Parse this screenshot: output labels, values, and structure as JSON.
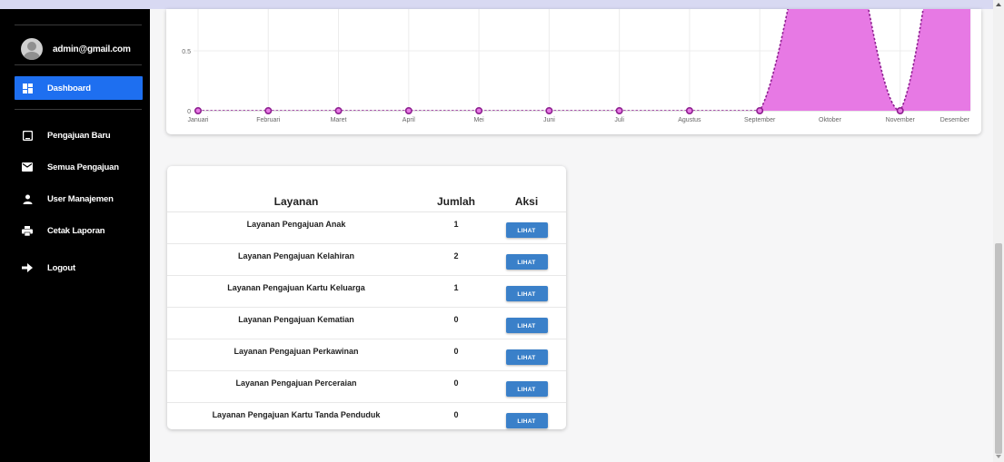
{
  "sidebar": {
    "user_email": "admin@gmail.com",
    "items": [
      {
        "label": "Dashboard",
        "icon": "dashboard-icon",
        "active": true
      },
      {
        "label": "Pengajuan Baru",
        "icon": "tablet-icon",
        "active": false
      },
      {
        "label": "Semua Pengajuan",
        "icon": "mail-icon",
        "active": false
      },
      {
        "label": "User Manajemen",
        "icon": "user-icon",
        "active": false
      },
      {
        "label": "Cetak Laporan",
        "icon": "printer-icon",
        "active": false
      },
      {
        "label": "Logout",
        "icon": "arrow-right-icon",
        "active": false
      }
    ],
    "active_color": "#1e6ff0"
  },
  "chart_data": {
    "type": "area",
    "categories": [
      "Januari",
      "Februari",
      "Maret",
      "April",
      "Mei",
      "Juni",
      "Juli",
      "Agustus",
      "September",
      "Oktober",
      "November",
      "Desember"
    ],
    "values": [
      0,
      0,
      0,
      0,
      0,
      0,
      0,
      0,
      0,
      2,
      0,
      4
    ],
    "ylim": [
      0,
      2
    ],
    "yticks": [
      0,
      0.5
    ],
    "fill_color": "#e779e4",
    "line_color": "#8e1f90",
    "grid": true
  },
  "table": {
    "headers": {
      "layanan": "Layanan",
      "jumlah": "Jumlah",
      "aksi": "Aksi"
    },
    "rows": [
      {
        "layanan": "Layanan Pengajuan Anak",
        "jumlah": "1",
        "aksi": "LIHAT"
      },
      {
        "layanan": "Layanan Pengajuan Kelahiran",
        "jumlah": "2",
        "aksi": "LIHAT"
      },
      {
        "layanan": "Layanan Pengajuan Kartu Keluarga",
        "jumlah": "1",
        "aksi": "LIHAT"
      },
      {
        "layanan": "Layanan Pengajuan Kematian",
        "jumlah": "0",
        "aksi": "LIHAT"
      },
      {
        "layanan": "Layanan Pengajuan Perkawinan",
        "jumlah": "0",
        "aksi": "LIHAT"
      },
      {
        "layanan": "Layanan Pengajuan Perceraian",
        "jumlah": "0",
        "aksi": "LIHAT"
      },
      {
        "layanan": "Layanan Pengajuan Kartu Tanda Penduduk",
        "jumlah": "0",
        "aksi": "LIHAT"
      }
    ],
    "button_color": "#3a80c9"
  }
}
